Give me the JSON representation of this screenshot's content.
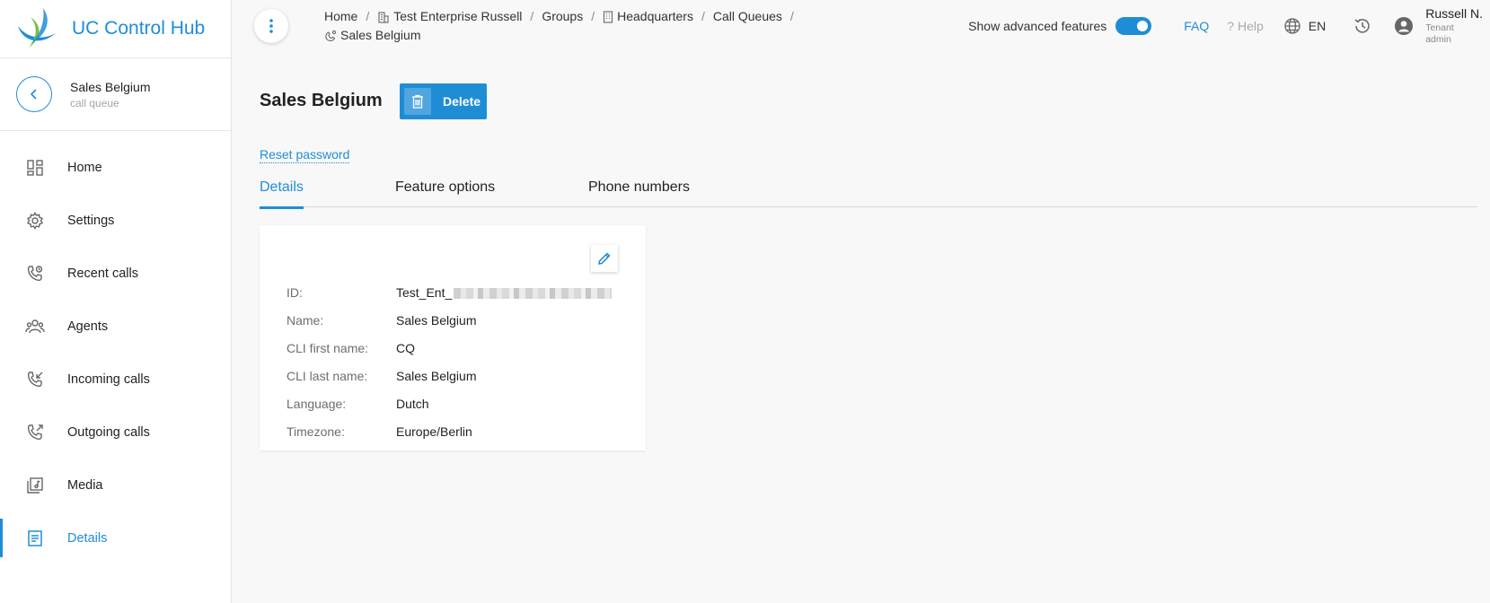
{
  "brand": {
    "title": "UC Control Hub"
  },
  "entity": {
    "name": "Sales Belgium",
    "type": "call queue"
  },
  "sidebar": {
    "items": [
      {
        "label": "Home",
        "icon": "dashboard-icon"
      },
      {
        "label": "Settings",
        "icon": "gear-icon"
      },
      {
        "label": "Recent calls",
        "icon": "phone-clock-icon"
      },
      {
        "label": "Agents",
        "icon": "people-icon"
      },
      {
        "label": "Incoming calls",
        "icon": "phone-incoming-icon"
      },
      {
        "label": "Outgoing calls",
        "icon": "phone-outgoing-icon"
      },
      {
        "label": "Media",
        "icon": "media-icon"
      },
      {
        "label": "Details",
        "icon": "document-icon",
        "active": true
      }
    ]
  },
  "breadcrumbs": {
    "home": "Home",
    "enterprise": "Test Enterprise Russell",
    "groups": "Groups",
    "headquarters": "Headquarters",
    "call_queues": "Call Queues",
    "current": "Sales Belgium"
  },
  "header": {
    "advanced_label": "Show advanced features",
    "advanced_enabled": true,
    "faq": "FAQ",
    "help": "? Help",
    "language": "EN",
    "user_name": "Russell N.",
    "user_role": "Tenant admin"
  },
  "page": {
    "title": "Sales Belgium",
    "delete_label": "Delete",
    "reset_password": "Reset password"
  },
  "tabs": [
    {
      "label": "Details",
      "active": true
    },
    {
      "label": "Feature options"
    },
    {
      "label": "Phone numbers"
    }
  ],
  "details": {
    "id_label": "ID:",
    "id_value": "Test_Ent_",
    "name_label": "Name:",
    "name_value": "Sales Belgium",
    "cli_first_label": "CLI first name:",
    "cli_first_value": "CQ",
    "cli_last_label": "CLI last name:",
    "cli_last_value": "Sales Belgium",
    "language_label": "Language:",
    "language_value": "Dutch",
    "timezone_label": "Timezone:",
    "timezone_value": "Europe/Berlin"
  },
  "colors": {
    "accent": "#1f8dd6",
    "background": "#f8f8f8",
    "muted": "#a9a9a9"
  }
}
